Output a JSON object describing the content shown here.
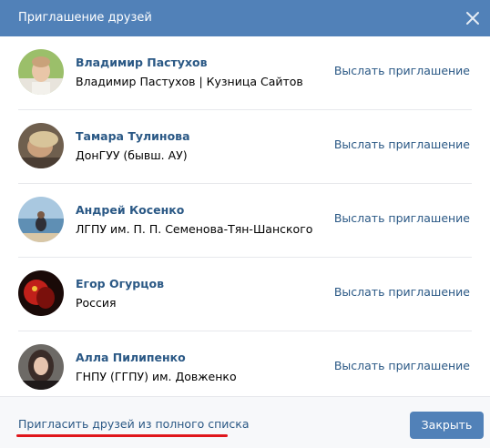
{
  "dialog": {
    "title": "Приглашение друзей",
    "close_icon": "close-icon"
  },
  "friends": [
    {
      "name": "Владимир Пастухов",
      "description": "Владимир Пастухов | Кузница Сайтов",
      "invite_label": "Выслать приглашение"
    },
    {
      "name": "Тамара Тулинова",
      "description": "ДонГУУ (бывш. АУ)",
      "invite_label": "Выслать приглашение"
    },
    {
      "name": "Андрей Косенко",
      "description": "ЛГПУ им. П. П. Семенова-Тян-Шанского",
      "invite_label": "Выслать приглашение"
    },
    {
      "name": "Егор Огурцов",
      "description": "Россия",
      "invite_label": "Выслать приглашение"
    },
    {
      "name": "Алла Пилипенко",
      "description": "ГНПУ (ГГПУ) им. Довженко",
      "invite_label": "Выслать приглашение"
    }
  ],
  "footer": {
    "full_list_link": "Пригласить друзей из полного списка",
    "close_button": "Закрыть"
  },
  "colors": {
    "header": "#5181b8",
    "link": "#2a5885",
    "highlight_underline": "#e0161c"
  }
}
